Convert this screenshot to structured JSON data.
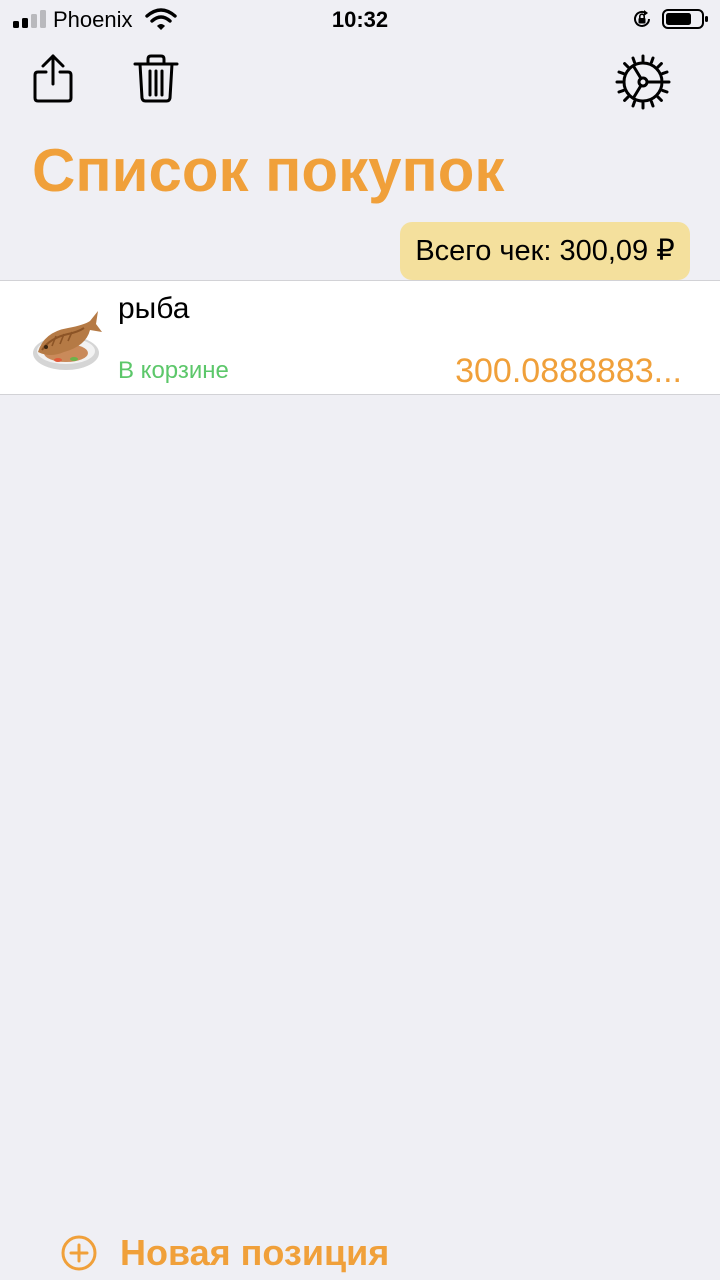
{
  "status_bar": {
    "carrier": "Phoenix",
    "time": "10:32",
    "signal_bars_on": 2,
    "signal_bars_total": 4,
    "battery_level": 0.75,
    "icons": [
      "signal-icon",
      "wifi-icon",
      "orientation-lock-icon",
      "battery-icon"
    ]
  },
  "toolbar": {
    "share_icon": "share-icon",
    "trash_icon": "trash-icon",
    "settings_icon": "settings-gear-icon"
  },
  "page": {
    "title": "Список покупок",
    "total": "Всего чек: 300,09 ₽"
  },
  "items": [
    {
      "name": "рыба",
      "status": "В корзине",
      "price": "300.0888883...",
      "icon": "fish-icon"
    }
  ],
  "footer": {
    "add_label": "Новая позиция",
    "add_icon": "plus-circle-icon"
  },
  "colors": {
    "accent": "#f0a03a",
    "in_cart": "#5cc76a",
    "total_badge": "#f4e09d",
    "background": "#efeff4"
  }
}
